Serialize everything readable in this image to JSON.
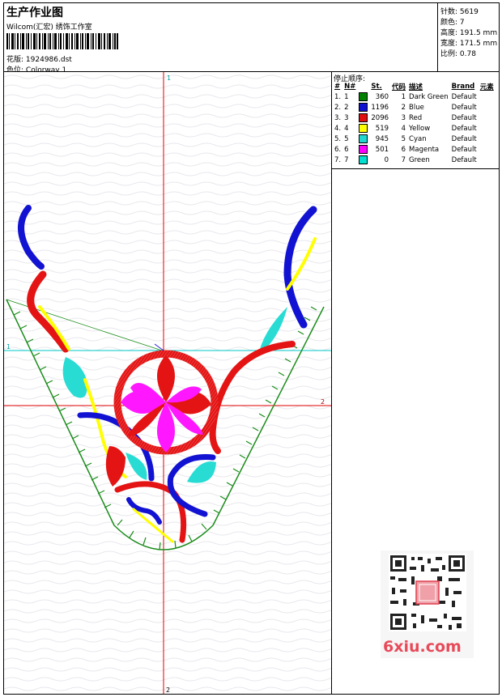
{
  "header": {
    "title": "生产作业图",
    "subtitle": "Wilcom(汇宏) 绣饰工作室",
    "file_label": "花版:",
    "file_value": "1924986.dst",
    "colorway_label": "色位:",
    "colorway_value": "Colorway 1"
  },
  "stats": {
    "stitches": {
      "label": "针数:",
      "value": "5619"
    },
    "colors": {
      "label": "颜色:",
      "value": "7"
    },
    "height": {
      "label": "高度:",
      "value": "191.5 mm"
    },
    "width": {
      "label": "宽度:",
      "value": "171.5 mm"
    },
    "scale": {
      "label": "比例:",
      "value": "0.78"
    }
  },
  "stop_sequence": {
    "title": "停止顺序:",
    "columns": [
      "#",
      "N#",
      "St.",
      "代码",
      "描述",
      "Brand",
      "元素"
    ],
    "rows": [
      {
        "idx": "1.",
        "n": "1",
        "color": "#008000",
        "st": "360",
        "code": "1",
        "desc": "Dark Green",
        "brand": "Default"
      },
      {
        "idx": "2.",
        "n": "2",
        "color": "#1010d0",
        "st": "1196",
        "code": "2",
        "desc": "Blue",
        "brand": "Default"
      },
      {
        "idx": "3.",
        "n": "3",
        "color": "#e01010",
        "st": "2096",
        "code": "3",
        "desc": "Red",
        "brand": "Default"
      },
      {
        "idx": "4.",
        "n": "4",
        "color": "#ffff00",
        "st": "519",
        "code": "4",
        "desc": "Yellow",
        "brand": "Default"
      },
      {
        "idx": "5.",
        "n": "5",
        "color": "#20d8d0",
        "st": "945",
        "code": "5",
        "desc": "Cyan",
        "brand": "Default"
      },
      {
        "idx": "6.",
        "n": "6",
        "color": "#ff00ff",
        "st": "501",
        "code": "6",
        "desc": "Magenta",
        "brand": "Default"
      },
      {
        "idx": "7.",
        "n": "7",
        "color": "#00e0d0",
        "st": "0",
        "code": "7",
        "desc": "Green",
        "brand": "Default"
      }
    ]
  },
  "axes": {
    "top_label": "1",
    "left_label": "1",
    "right_label": "2",
    "bottom_label": "2"
  },
  "watermark": {
    "text": "6xiu.com"
  },
  "colors": {
    "dark_green": "#1a8c1a",
    "blue": "#1212d2",
    "red": "#e41414",
    "yellow": "#ffff00",
    "cyan": "#28dcd4",
    "magenta": "#ff18ff",
    "axis_red": "#e00000",
    "axis_cyan": "#00c8c8"
  }
}
